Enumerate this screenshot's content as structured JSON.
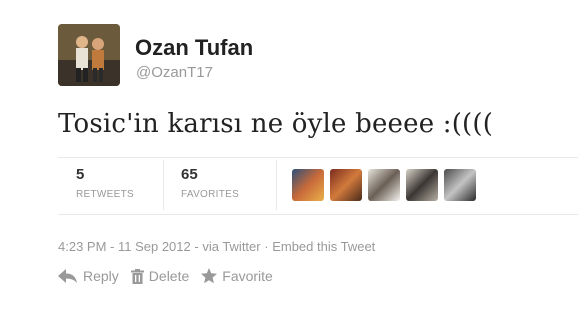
{
  "tweet": {
    "author_name": "Ozan Tufan",
    "author_handle": "@OzanT17",
    "text": "Tosic'in karısı ne öyle beeee :((((",
    "retweets_count": "5",
    "retweets_label": "RETWEETS",
    "favorites_count": "65",
    "favorites_label": "FAVORITES",
    "timestamp": "4:23 PM - 11 Sep 2012",
    "via": "via Twitter",
    "embed": "Embed this Tweet"
  },
  "actions": {
    "reply": "Reply",
    "delete": "Delete",
    "favorite": "Favorite"
  },
  "colors": {
    "muted": "#999999",
    "text": "#222222"
  }
}
